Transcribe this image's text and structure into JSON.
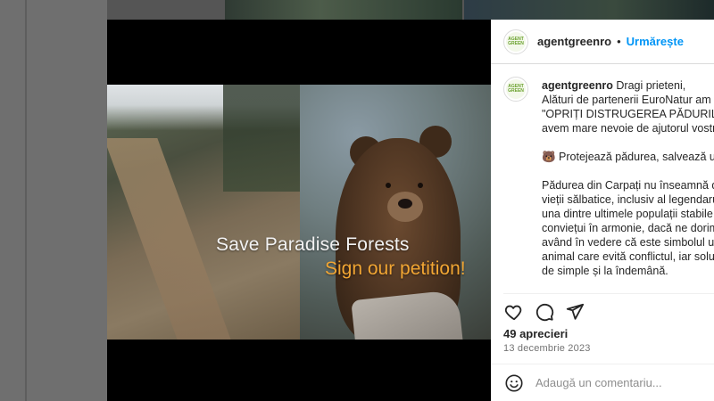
{
  "post": {
    "username": "agentgreenro",
    "dot": "•",
    "follow_label": "Urmărește",
    "avatar_text": "AGENT GREEN",
    "overlay_title": "Save Paradise Forests",
    "overlay_subtitle": "Sign our petition!",
    "caption": {
      "first_line": "Dragi prieteni,",
      "lines_a": [
        "Alături de partenerii EuroNatur am la",
        "\"OPRIȚI DISTRUGEREA PĂDURILOR R",
        "avem mare nevoie de ajutorul vostru"
      ],
      "emoji_line": "🐻 Protejează pădurea, salvează ursu",
      "lines_b": [
        "Pădurea din Carpați nu înseamnă doa",
        "vieții sălbatice, inclusiv al legendarulu",
        "una dintre ultimele populații stabile d",
        "conviețui în armonie, dacă ne dorim;",
        "având în vedere că este simbolul unu",
        "animal care evită conflictul, iar soluți",
        "de simple și la îndemână."
      ]
    },
    "likes": "49 aprecieri",
    "date": "13 decembrie 2023",
    "comment_placeholder": "Adaugă un comentariu..."
  },
  "icons": [
    "heart-icon",
    "comment-icon",
    "share-icon",
    "emoji-icon"
  ]
}
